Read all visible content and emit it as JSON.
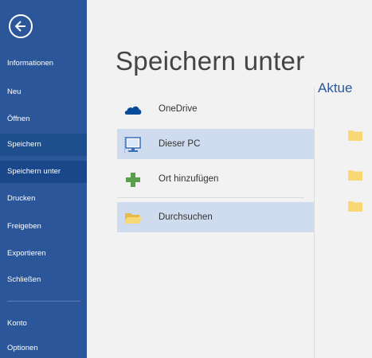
{
  "nav": {
    "items": [
      {
        "label": "Informationen"
      },
      {
        "label": "Neu"
      },
      {
        "label": "Öffnen"
      },
      {
        "label": "Speichern"
      },
      {
        "label": "Speichern unter"
      },
      {
        "label": "Drucken"
      },
      {
        "label": "Freigeben"
      },
      {
        "label": "Exportieren"
      },
      {
        "label": "Schließen"
      },
      {
        "label": "Konto"
      },
      {
        "label": "Optionen"
      }
    ]
  },
  "main": {
    "title": "Speichern unter",
    "locations": [
      {
        "label": "OneDrive",
        "icon": "onedrive-cloud-icon"
      },
      {
        "label": "Dieser PC",
        "icon": "computer-icon"
      },
      {
        "label": "Ort hinzufügen",
        "icon": "plus-icon"
      },
      {
        "label": "Durchsuchen",
        "icon": "folder-open-icon"
      }
    ],
    "recent_heading": "Aktue",
    "recent_folders": [
      "folder-icon",
      "folder-icon",
      "folder-icon"
    ]
  },
  "colors": {
    "nav_bg": "#2b579a",
    "nav_selected": "#1e4e8c",
    "location_selected": "#cfdcef",
    "accent": "#2b579a",
    "folder": "#f8d775"
  }
}
